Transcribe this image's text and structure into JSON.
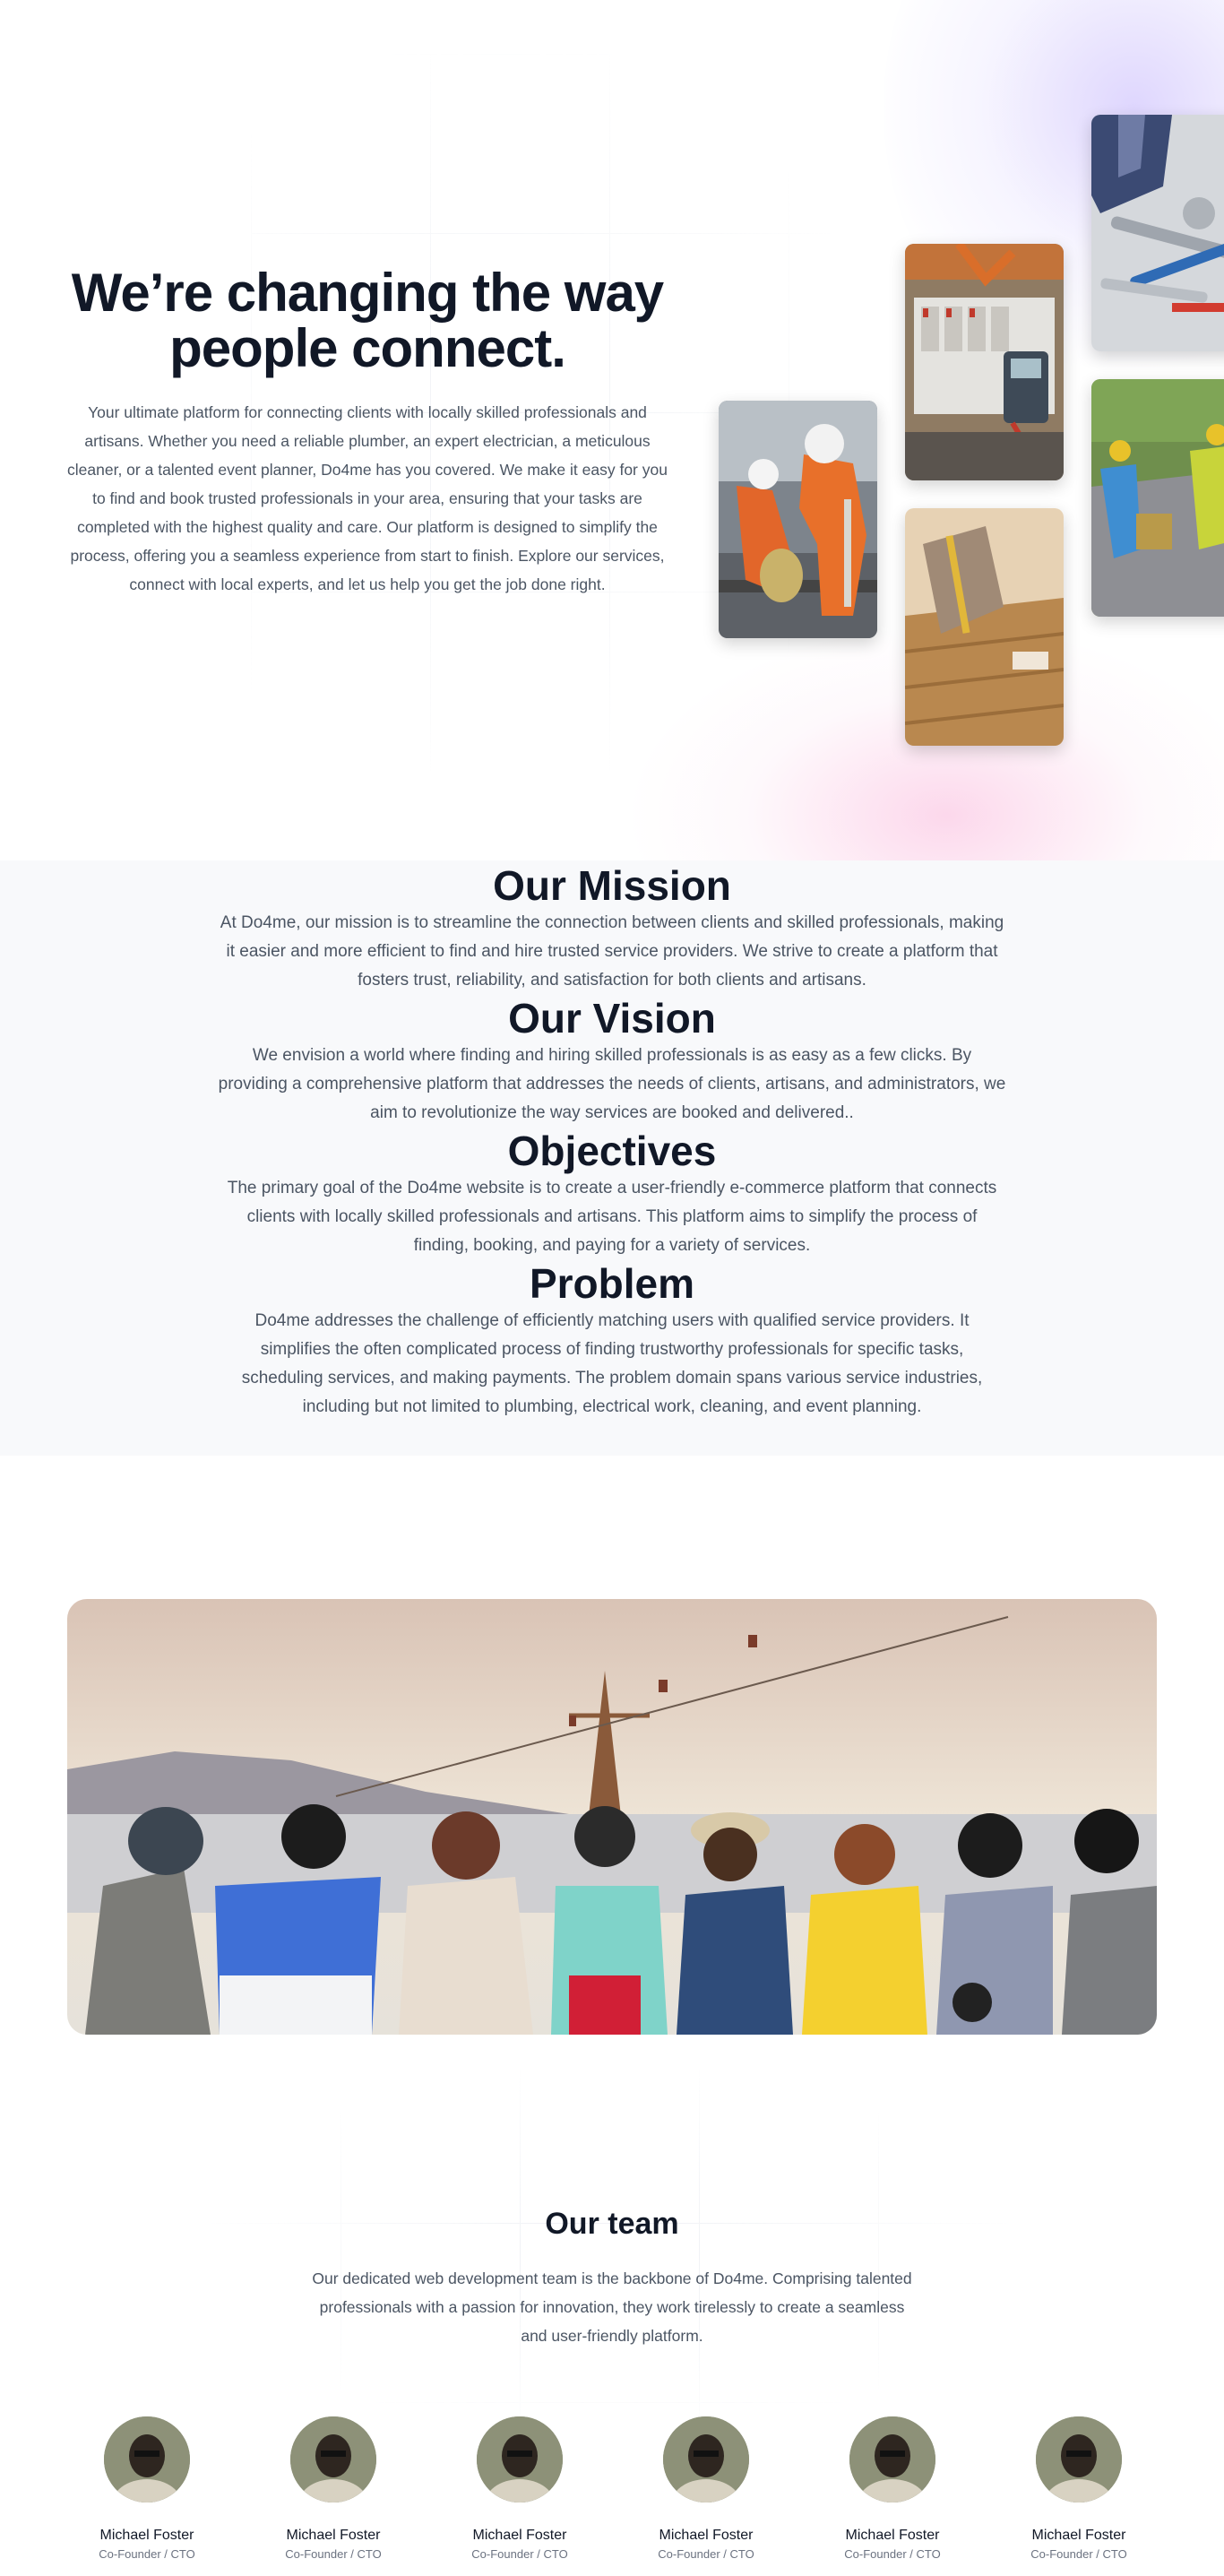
{
  "hero": {
    "title": "We’re changing the way people connect.",
    "description": "Your ultimate platform for connecting clients with locally skilled professionals and artisans. Whether you need a reliable plumber, an expert electrician, a meticulous cleaner, or a talented event planner, Do4me has you covered. We make it easy for you to find and book trusted professionals in your area, ensuring that your tasks are completed with the highest quality and care. Our platform is designed to simplify the process, offering you a seamless experience from start to finish. Explore our services, connect with local experts, and let us help you get the job done right.",
    "images": [
      "construction-workers-photo",
      "electrician-panel-photo",
      "carpenter-wood-photo",
      "plumbing-tools-photo",
      "site-workers-photo"
    ]
  },
  "info": [
    {
      "title": "Our Mission",
      "text": "At Do4me, our mission is to streamline the connection between clients and skilled professionals, making it easier and more efficient to find and hire trusted service providers. We strive to create a platform that fosters trust, reliability, and satisfaction for both clients and artisans."
    },
    {
      "title": "Our Vision",
      "text": "We envision a world where finding and hiring skilled professionals is as easy as a few clicks. By providing a comprehensive platform that addresses the needs of clients, artisans, and administrators, we aim to revolutionize the way services are booked and delivered.."
    },
    {
      "title": "Objectives",
      "text": "The primary goal of the Do4me website is to create a user-friendly e-commerce platform that connects clients with locally skilled professionals and artisans. This platform aims to simplify the process of finding, booking, and paying for a variety of services."
    },
    {
      "title": "Problem",
      "text": "Do4me addresses the challenge of efficiently matching users with qualified service providers. It simplifies the often complicated process of finding trustworthy professionals for specific tasks, scheduling services, and making payments. The problem domain spans various service industries, including but not limited to plumbing, electrical work, cleaning, and event planning."
    }
  ],
  "team": {
    "title": "Our team",
    "description": "Our dedicated web development team is the backbone of Do4me. Comprising talented professionals with a passion for innovation, they work tirelessly to create a seamless and user-friendly platform.",
    "members": [
      {
        "name": "Michael Foster",
        "role": "Co-Founder / CTO"
      },
      {
        "name": "Michael Foster",
        "role": "Co-Founder / CTO"
      },
      {
        "name": "Michael Foster",
        "role": "Co-Founder / CTO"
      },
      {
        "name": "Michael Foster",
        "role": "Co-Founder / CTO"
      },
      {
        "name": "Michael Foster",
        "role": "Co-Founder / CTO"
      },
      {
        "name": "Michael Foster",
        "role": "Co-Founder / CTO"
      }
    ]
  },
  "colors": {
    "heading": "#111827",
    "body_text": "#4b5563",
    "section_bg": "#f8f9fb"
  }
}
